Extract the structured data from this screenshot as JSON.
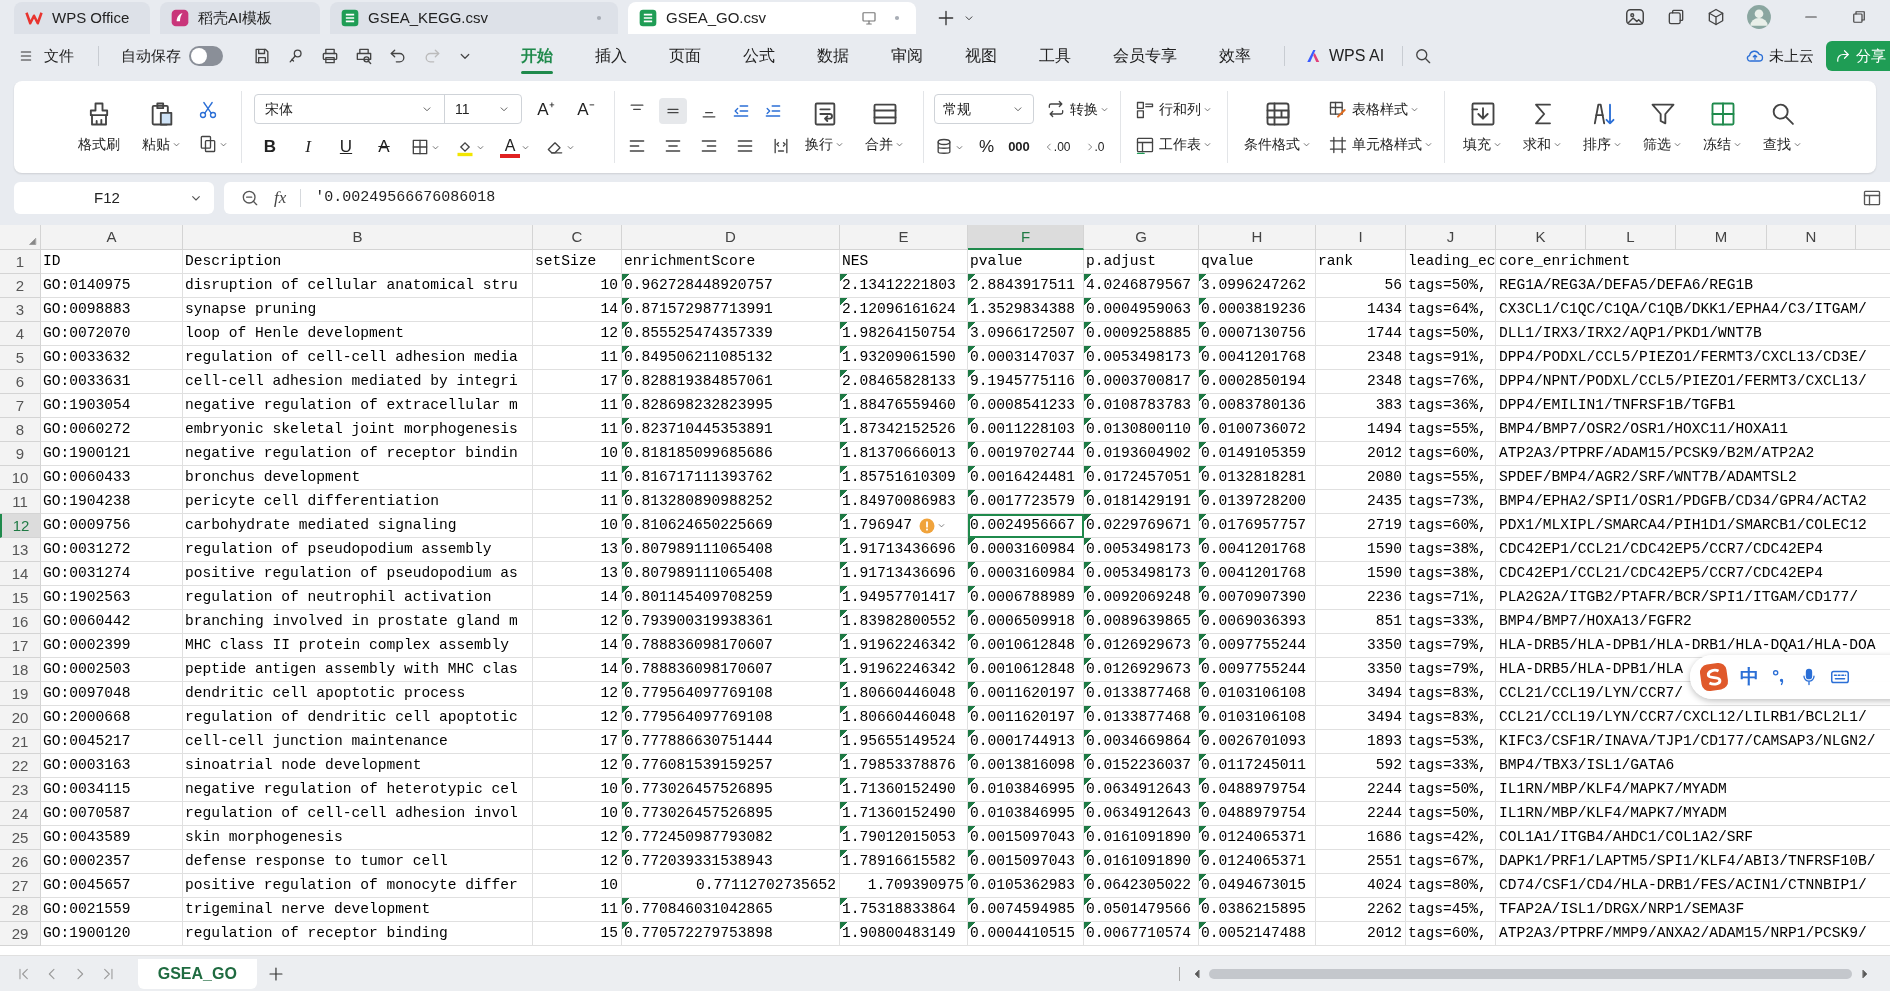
{
  "tabs": [
    {
      "label": "WPS Office",
      "kind": "app",
      "selected": false
    },
    {
      "label": "稻壳AI模板",
      "kind": "template",
      "selected": false
    },
    {
      "label": "GSEA_KEGG.csv",
      "kind": "sheet",
      "selected": false
    },
    {
      "label": "GSEA_GO.csv",
      "kind": "sheet",
      "selected": true
    }
  ],
  "quick_access": {
    "file_menu": "文件",
    "autosave_label": "自动保存",
    "autosave_on": false
  },
  "menu_tabs": [
    {
      "label": "开始",
      "selected": true
    },
    {
      "label": "插入",
      "selected": false
    },
    {
      "label": "页面",
      "selected": false
    },
    {
      "label": "公式",
      "selected": false
    },
    {
      "label": "数据",
      "selected": false
    },
    {
      "label": "审阅",
      "selected": false
    },
    {
      "label": "视图",
      "selected": false
    },
    {
      "label": "工具",
      "selected": false
    },
    {
      "label": "会员专享",
      "selected": false
    },
    {
      "label": "效率",
      "selected": false
    }
  ],
  "ai_button": "WPS AI",
  "cloud_status": "未上云",
  "share_button": "分享",
  "ribbon": {
    "format_painter": "格式刷",
    "paste": "粘贴",
    "font_name": "宋体",
    "font_size": "11",
    "grow_font": "A⁺",
    "shrink_font": "A⁻",
    "bold": "B",
    "italic": "I",
    "underline": "U",
    "strikethrough": "A",
    "font_color": "A",
    "align_middle_on": true,
    "wrap_text": "换行",
    "merge": "合并",
    "number_format": "常规",
    "convert": "转换",
    "percent": "%",
    "thousands": "000",
    "decimal_increase": ".00",
    "decimal_decrease": ".0",
    "rows_columns": "行和列",
    "worksheet": "工作表",
    "conditional_format": "条件格式",
    "table_style": "表格样式",
    "cell_style": "单元格样式",
    "fill": "填充",
    "sum": "求和",
    "sort": "排序",
    "filter": "筛选",
    "freeze": "冻结",
    "find": "查找"
  },
  "formula_bar": {
    "name_box": "F12",
    "fx": "fx",
    "formula": "'0.00249566676086018"
  },
  "columns": [
    {
      "letter": "A",
      "selected": false
    },
    {
      "letter": "B",
      "selected": false
    },
    {
      "letter": "C",
      "selected": false
    },
    {
      "letter": "D",
      "selected": false
    },
    {
      "letter": "E",
      "selected": false
    },
    {
      "letter": "F",
      "selected": true
    },
    {
      "letter": "G",
      "selected": false
    },
    {
      "letter": "H",
      "selected": false
    },
    {
      "letter": "I",
      "selected": false
    },
    {
      "letter": "J",
      "selected": false
    },
    {
      "letter": "K",
      "selected": false
    },
    {
      "letter": "L",
      "selected": false
    },
    {
      "letter": "M",
      "selected": false
    },
    {
      "letter": "N",
      "selected": false
    }
  ],
  "rows": [
    {
      "number": "1",
      "selected": false,
      "warning": false,
      "cells": [
        {
          "text": "ID",
          "kind": "text"
        },
        {
          "text": "Description",
          "kind": "text"
        },
        {
          "text": "setSize",
          "kind": "text"
        },
        {
          "text": "enrichmentScore",
          "kind": "text"
        },
        {
          "text": "NES",
          "kind": "text"
        },
        {
          "text": "pvalue",
          "kind": "text"
        },
        {
          "text": "p.adjust",
          "kind": "text"
        },
        {
          "text": "qvalue",
          "kind": "text"
        },
        {
          "text": "rank",
          "kind": "text"
        },
        {
          "text": "leading_ec",
          "kind": "text"
        },
        {
          "text": "core_enrichment",
          "kind": "text"
        }
      ]
    },
    {
      "number": "2",
      "selected": false,
      "warning": false,
      "cells": [
        {
          "text": "GO:0140975",
          "kind": "text"
        },
        {
          "text": "disruption of cellular anatomical stru",
          "kind": "text"
        },
        {
          "text": "10",
          "kind": "number"
        },
        {
          "text": "0.962728448920757",
          "kind": "numeric_text"
        },
        {
          "text": "2.13412221803",
          "kind": "numeric_text"
        },
        {
          "text": "2.8843917511",
          "kind": "numeric_text"
        },
        {
          "text": "4.0246879567",
          "kind": "numeric_text"
        },
        {
          "text": "3.0996247262",
          "kind": "numeric_text"
        },
        {
          "text": "56",
          "kind": "number"
        },
        {
          "text": "tags=50%,",
          "kind": "text"
        },
        {
          "text": "REG1A/REG3A/DEFA5/DEFA6/REG1B",
          "kind": "text"
        }
      ]
    },
    {
      "number": "3",
      "selected": false,
      "warning": false,
      "cells": [
        {
          "text": "GO:0098883",
          "kind": "text"
        },
        {
          "text": "synapse pruning",
          "kind": "text"
        },
        {
          "text": "14",
          "kind": "number"
        },
        {
          "text": "0.871572987713991",
          "kind": "numeric_text"
        },
        {
          "text": "2.12096161624",
          "kind": "numeric_text"
        },
        {
          "text": "1.3529834388",
          "kind": "numeric_text"
        },
        {
          "text": "0.0004959063",
          "kind": "numeric_text"
        },
        {
          "text": "0.0003819236",
          "kind": "numeric_text"
        },
        {
          "text": "1434",
          "kind": "number"
        },
        {
          "text": "tags=64%,",
          "kind": "text"
        },
        {
          "text": "CX3CL1/C1QC/C1QA/C1QB/DKK1/EPHA4/C3/ITGAM/",
          "kind": "text"
        }
      ]
    },
    {
      "number": "4",
      "selected": false,
      "warning": false,
      "cells": [
        {
          "text": "GO:0072070",
          "kind": "text"
        },
        {
          "text": "loop of Henle development",
          "kind": "text"
        },
        {
          "text": "12",
          "kind": "number"
        },
        {
          "text": "0.855525474357339",
          "kind": "numeric_text"
        },
        {
          "text": "1.98264150754",
          "kind": "numeric_text"
        },
        {
          "text": "3.0966172507",
          "kind": "numeric_text"
        },
        {
          "text": "0.0009258885",
          "kind": "numeric_text"
        },
        {
          "text": "0.0007130756",
          "kind": "numeric_text"
        },
        {
          "text": "1744",
          "kind": "number"
        },
        {
          "text": "tags=50%,",
          "kind": "text"
        },
        {
          "text": "DLL1/IRX3/IRX2/AQP1/PKD1/WNT7B",
          "kind": "text"
        }
      ]
    },
    {
      "number": "5",
      "selected": false,
      "warning": false,
      "cells": [
        {
          "text": "GO:0033632",
          "kind": "text"
        },
        {
          "text": "regulation of cell-cell adhesion media",
          "kind": "text"
        },
        {
          "text": "11",
          "kind": "number"
        },
        {
          "text": "0.849506211085132",
          "kind": "numeric_text"
        },
        {
          "text": "1.93209061590",
          "kind": "numeric_text"
        },
        {
          "text": "0.0003147037",
          "kind": "numeric_text"
        },
        {
          "text": "0.0053498173",
          "kind": "numeric_text"
        },
        {
          "text": "0.0041201768",
          "kind": "numeric_text"
        },
        {
          "text": "2348",
          "kind": "number"
        },
        {
          "text": "tags=91%,",
          "kind": "text"
        },
        {
          "text": "DPP4/PODXL/CCL5/PIEZO1/FERMT3/CXCL13/CD3E/",
          "kind": "text"
        }
      ]
    },
    {
      "number": "6",
      "selected": false,
      "warning": false,
      "cells": [
        {
          "text": "GO:0033631",
          "kind": "text"
        },
        {
          "text": "cell-cell adhesion mediated by integri",
          "kind": "text"
        },
        {
          "text": "17",
          "kind": "number"
        },
        {
          "text": "0.828819384857061",
          "kind": "numeric_text"
        },
        {
          "text": "2.08465828133",
          "kind": "numeric_text"
        },
        {
          "text": "9.1945775116",
          "kind": "numeric_text"
        },
        {
          "text": "0.0003700817",
          "kind": "numeric_text"
        },
        {
          "text": "0.0002850194",
          "kind": "numeric_text"
        },
        {
          "text": "2348",
          "kind": "number"
        },
        {
          "text": "tags=76%,",
          "kind": "text"
        },
        {
          "text": "DPP4/NPNT/PODXL/CCL5/PIEZO1/FERMT3/CXCL13/",
          "kind": "text"
        }
      ]
    },
    {
      "number": "7",
      "selected": false,
      "warning": false,
      "cells": [
        {
          "text": "GO:1903054",
          "kind": "text"
        },
        {
          "text": "negative regulation of extracellular m",
          "kind": "text"
        },
        {
          "text": "11",
          "kind": "number"
        },
        {
          "text": "0.828698232823995",
          "kind": "numeric_text"
        },
        {
          "text": "1.88476559460",
          "kind": "numeric_text"
        },
        {
          "text": "0.0008541233",
          "kind": "numeric_text"
        },
        {
          "text": "0.0108783783",
          "kind": "numeric_text"
        },
        {
          "text": "0.0083780136",
          "kind": "numeric_text"
        },
        {
          "text": "383",
          "kind": "number"
        },
        {
          "text": "tags=36%,",
          "kind": "text"
        },
        {
          "text": "DPP4/EMILIN1/TNFRSF1B/TGFB1",
          "kind": "text"
        }
      ]
    },
    {
      "number": "8",
      "selected": false,
      "warning": false,
      "cells": [
        {
          "text": "GO:0060272",
          "kind": "text"
        },
        {
          "text": "embryonic skeletal joint morphogenesis",
          "kind": "text"
        },
        {
          "text": "11",
          "kind": "number"
        },
        {
          "text": "0.823710445353891",
          "kind": "numeric_text"
        },
        {
          "text": "1.87342152526",
          "kind": "numeric_text"
        },
        {
          "text": "0.0011228103",
          "kind": "numeric_text"
        },
        {
          "text": "0.0130800110",
          "kind": "numeric_text"
        },
        {
          "text": "0.0100736072",
          "kind": "numeric_text"
        },
        {
          "text": "1494",
          "kind": "number"
        },
        {
          "text": "tags=55%,",
          "kind": "text"
        },
        {
          "text": "BMP4/BMP7/OSR2/OSR1/HOXC11/HOXA11",
          "kind": "text"
        }
      ]
    },
    {
      "number": "9",
      "selected": false,
      "warning": false,
      "cells": [
        {
          "text": "GO:1900121",
          "kind": "text"
        },
        {
          "text": "negative regulation of receptor bindin",
          "kind": "text"
        },
        {
          "text": "10",
          "kind": "number"
        },
        {
          "text": "0.818185099685686",
          "kind": "numeric_text"
        },
        {
          "text": "1.81370666013",
          "kind": "numeric_text"
        },
        {
          "text": "0.0019702744",
          "kind": "numeric_text"
        },
        {
          "text": "0.0193604902",
          "kind": "numeric_text"
        },
        {
          "text": "0.0149105359",
          "kind": "numeric_text"
        },
        {
          "text": "2012",
          "kind": "number"
        },
        {
          "text": "tags=60%,",
          "kind": "text"
        },
        {
          "text": "ATP2A3/PTPRF/ADAM15/PCSK9/B2M/ATP2A2",
          "kind": "text"
        }
      ]
    },
    {
      "number": "10",
      "selected": false,
      "warning": false,
      "cells": [
        {
          "text": "GO:0060433",
          "kind": "text"
        },
        {
          "text": "bronchus development",
          "kind": "text"
        },
        {
          "text": "11",
          "kind": "number"
        },
        {
          "text": "0.816717111393762",
          "kind": "numeric_text"
        },
        {
          "text": "1.85751610309",
          "kind": "numeric_text"
        },
        {
          "text": "0.0016424481",
          "kind": "numeric_text"
        },
        {
          "text": "0.0172457051",
          "kind": "numeric_text"
        },
        {
          "text": "0.0132818281",
          "kind": "numeric_text"
        },
        {
          "text": "2080",
          "kind": "number"
        },
        {
          "text": "tags=55%,",
          "kind": "text"
        },
        {
          "text": "SPDEF/BMP4/AGR2/SRF/WNT7B/ADAMTSL2",
          "kind": "text"
        }
      ]
    },
    {
      "number": "11",
      "selected": false,
      "warning": false,
      "cells": [
        {
          "text": "GO:1904238",
          "kind": "text"
        },
        {
          "text": "pericyte cell differentiation",
          "kind": "text"
        },
        {
          "text": "11",
          "kind": "number"
        },
        {
          "text": "0.813280890988252",
          "kind": "numeric_text"
        },
        {
          "text": "1.84970086983",
          "kind": "numeric_text"
        },
        {
          "text": "0.0017723579",
          "kind": "numeric_text"
        },
        {
          "text": "0.0181429191",
          "kind": "numeric_text"
        },
        {
          "text": "0.0139728200",
          "kind": "numeric_text"
        },
        {
          "text": "2435",
          "kind": "number"
        },
        {
          "text": "tags=73%,",
          "kind": "text"
        },
        {
          "text": "BMP4/EPHA2/SPI1/OSR1/PDGFB/CD34/GPR4/ACTA2",
          "kind": "text"
        }
      ]
    },
    {
      "number": "12",
      "selected": true,
      "warning": true,
      "cells": [
        {
          "text": "GO:0009756",
          "kind": "text"
        },
        {
          "text": "carbohydrate mediated signaling",
          "kind": "text"
        },
        {
          "text": "10",
          "kind": "number"
        },
        {
          "text": "0.810624650225669",
          "kind": "numeric_text"
        },
        {
          "text": "1.796947",
          "kind": "numeric_text"
        },
        {
          "text": "0.0024956667",
          "kind": "numeric_text"
        },
        {
          "text": "0.0229769671",
          "kind": "numeric_text"
        },
        {
          "text": "0.0176957757",
          "kind": "numeric_text"
        },
        {
          "text": "2719",
          "kind": "number"
        },
        {
          "text": "tags=60%,",
          "kind": "text"
        },
        {
          "text": "PDX1/MLXIPL/SMARCA4/PIH1D1/SMARCB1/COLEC12",
          "kind": "text"
        }
      ]
    },
    {
      "number": "13",
      "selected": false,
      "warning": false,
      "cells": [
        {
          "text": "GO:0031272",
          "kind": "text"
        },
        {
          "text": "regulation of pseudopodium assembly",
          "kind": "text"
        },
        {
          "text": "13",
          "kind": "number"
        },
        {
          "text": "0.807989111065408",
          "kind": "numeric_text"
        },
        {
          "text": "1.91713436696",
          "kind": "numeric_text"
        },
        {
          "text": "0.0003160984",
          "kind": "numeric_text"
        },
        {
          "text": "0.0053498173",
          "kind": "numeric_text"
        },
        {
          "text": "0.0041201768",
          "kind": "numeric_text"
        },
        {
          "text": "1590",
          "kind": "number"
        },
        {
          "text": "tags=38%,",
          "kind": "text"
        },
        {
          "text": "CDC42EP1/CCL21/CDC42EP5/CCR7/CDC42EP4",
          "kind": "text"
        }
      ]
    },
    {
      "number": "14",
      "selected": false,
      "warning": false,
      "cells": [
        {
          "text": "GO:0031274",
          "kind": "text"
        },
        {
          "text": "positive regulation of pseudopodium as",
          "kind": "text"
        },
        {
          "text": "13",
          "kind": "number"
        },
        {
          "text": "0.807989111065408",
          "kind": "numeric_text"
        },
        {
          "text": "1.91713436696",
          "kind": "numeric_text"
        },
        {
          "text": "0.0003160984",
          "kind": "numeric_text"
        },
        {
          "text": "0.0053498173",
          "kind": "numeric_text"
        },
        {
          "text": "0.0041201768",
          "kind": "numeric_text"
        },
        {
          "text": "1590",
          "kind": "number"
        },
        {
          "text": "tags=38%,",
          "kind": "text"
        },
        {
          "text": "CDC42EP1/CCL21/CDC42EP5/CCR7/CDC42EP4",
          "kind": "text"
        }
      ]
    },
    {
      "number": "15",
      "selected": false,
      "warning": false,
      "cells": [
        {
          "text": "GO:1902563",
          "kind": "text"
        },
        {
          "text": "regulation of neutrophil activation",
          "kind": "text"
        },
        {
          "text": "14",
          "kind": "number"
        },
        {
          "text": "0.801145409708259",
          "kind": "numeric_text"
        },
        {
          "text": "1.94957701417",
          "kind": "numeric_text"
        },
        {
          "text": "0.0006788989",
          "kind": "numeric_text"
        },
        {
          "text": "0.0092069248",
          "kind": "numeric_text"
        },
        {
          "text": "0.0070907390",
          "kind": "numeric_text"
        },
        {
          "text": "2236",
          "kind": "number"
        },
        {
          "text": "tags=71%,",
          "kind": "text"
        },
        {
          "text": "PLA2G2A/ITGB2/PTAFR/BCR/SPI1/ITGAM/CD177/",
          "kind": "text"
        }
      ]
    },
    {
      "number": "16",
      "selected": false,
      "warning": false,
      "cells": [
        {
          "text": "GO:0060442",
          "kind": "text"
        },
        {
          "text": "branching involved in prostate gland m",
          "kind": "text"
        },
        {
          "text": "12",
          "kind": "number"
        },
        {
          "text": "0.793900319938361",
          "kind": "numeric_text"
        },
        {
          "text": "1.83982800552",
          "kind": "numeric_text"
        },
        {
          "text": "0.0006509918",
          "kind": "numeric_text"
        },
        {
          "text": "0.0089639865",
          "kind": "numeric_text"
        },
        {
          "text": "0.0069036393",
          "kind": "numeric_text"
        },
        {
          "text": "851",
          "kind": "number"
        },
        {
          "text": "tags=33%,",
          "kind": "text"
        },
        {
          "text": "BMP4/BMP7/HOXA13/FGFR2",
          "kind": "text"
        }
      ]
    },
    {
      "number": "17",
      "selected": false,
      "warning": false,
      "cells": [
        {
          "text": "GO:0002399",
          "kind": "text"
        },
        {
          "text": "MHC class II protein complex assembly",
          "kind": "text"
        },
        {
          "text": "14",
          "kind": "number"
        },
        {
          "text": "0.788836098170607",
          "kind": "numeric_text"
        },
        {
          "text": "1.91962246342",
          "kind": "numeric_text"
        },
        {
          "text": "0.0010612848",
          "kind": "numeric_text"
        },
        {
          "text": "0.0126929673",
          "kind": "numeric_text"
        },
        {
          "text": "0.0097755244",
          "kind": "numeric_text"
        },
        {
          "text": "3350",
          "kind": "number"
        },
        {
          "text": "tags=79%,",
          "kind": "text"
        },
        {
          "text": "HLA-DRB5/HLA-DPB1/HLA-DRB1/HLA-DQA1/HLA-DOA",
          "kind": "text"
        }
      ]
    },
    {
      "number": "18",
      "selected": false,
      "warning": false,
      "cells": [
        {
          "text": "GO:0002503",
          "kind": "text"
        },
        {
          "text": "peptide antigen assembly with MHC clas",
          "kind": "text"
        },
        {
          "text": "14",
          "kind": "number"
        },
        {
          "text": "0.788836098170607",
          "kind": "numeric_text"
        },
        {
          "text": "1.91962246342",
          "kind": "numeric_text"
        },
        {
          "text": "0.0010612848",
          "kind": "numeric_text"
        },
        {
          "text": "0.0126929673",
          "kind": "numeric_text"
        },
        {
          "text": "0.0097755244",
          "kind": "numeric_text"
        },
        {
          "text": "3350",
          "kind": "number"
        },
        {
          "text": "tags=79%,",
          "kind": "text"
        },
        {
          "text": "HLA-DRB5/HLA-DPB1/HLA",
          "kind": "text"
        }
      ]
    },
    {
      "number": "19",
      "selected": false,
      "warning": false,
      "cells": [
        {
          "text": "GO:0097048",
          "kind": "text"
        },
        {
          "text": "dendritic cell apoptotic process",
          "kind": "text"
        },
        {
          "text": "12",
          "kind": "number"
        },
        {
          "text": "0.779564097769108",
          "kind": "numeric_text"
        },
        {
          "text": "1.80660446048",
          "kind": "numeric_text"
        },
        {
          "text": "0.0011620197",
          "kind": "numeric_text"
        },
        {
          "text": "0.0133877468",
          "kind": "numeric_text"
        },
        {
          "text": "0.0103106108",
          "kind": "numeric_text"
        },
        {
          "text": "3494",
          "kind": "number"
        },
        {
          "text": "tags=83%,",
          "kind": "text"
        },
        {
          "text": "CCL21/CCL19/LYN/CCR7/",
          "kind": "text"
        }
      ]
    },
    {
      "number": "20",
      "selected": false,
      "warning": false,
      "cells": [
        {
          "text": "GO:2000668",
          "kind": "text"
        },
        {
          "text": "regulation of dendritic cell apoptotic",
          "kind": "text"
        },
        {
          "text": "12",
          "kind": "number"
        },
        {
          "text": "0.779564097769108",
          "kind": "numeric_text"
        },
        {
          "text": "1.80660446048",
          "kind": "numeric_text"
        },
        {
          "text": "0.0011620197",
          "kind": "numeric_text"
        },
        {
          "text": "0.0133877468",
          "kind": "numeric_text"
        },
        {
          "text": "0.0103106108",
          "kind": "numeric_text"
        },
        {
          "text": "3494",
          "kind": "number"
        },
        {
          "text": "tags=83%,",
          "kind": "text"
        },
        {
          "text": "CCL21/CCL19/LYN/CCR7/CXCL12/LILRB1/BCL2L1/",
          "kind": "text"
        }
      ]
    },
    {
      "number": "21",
      "selected": false,
      "warning": false,
      "cells": [
        {
          "text": "GO:0045217",
          "kind": "text"
        },
        {
          "text": "cell-cell junction maintenance",
          "kind": "text"
        },
        {
          "text": "17",
          "kind": "number"
        },
        {
          "text": "0.777886630751444",
          "kind": "numeric_text"
        },
        {
          "text": "1.95655149524",
          "kind": "numeric_text"
        },
        {
          "text": "0.0001744913",
          "kind": "numeric_text"
        },
        {
          "text": "0.0034669864",
          "kind": "numeric_text"
        },
        {
          "text": "0.0026701093",
          "kind": "numeric_text"
        },
        {
          "text": "1893",
          "kind": "number"
        },
        {
          "text": "tags=53%,",
          "kind": "text"
        },
        {
          "text": "KIFC3/CSF1R/INAVA/TJP1/CD177/CAMSAP3/NLGN2/",
          "kind": "text"
        }
      ]
    },
    {
      "number": "22",
      "selected": false,
      "warning": false,
      "cells": [
        {
          "text": "GO:0003163",
          "kind": "text"
        },
        {
          "text": "sinoatrial node development",
          "kind": "text"
        },
        {
          "text": "12",
          "kind": "number"
        },
        {
          "text": "0.776081539159257",
          "kind": "numeric_text"
        },
        {
          "text": "1.79853378876",
          "kind": "numeric_text"
        },
        {
          "text": "0.0013816098",
          "kind": "numeric_text"
        },
        {
          "text": "0.0152236037",
          "kind": "numeric_text"
        },
        {
          "text": "0.0117245011",
          "kind": "numeric_text"
        },
        {
          "text": "592",
          "kind": "number"
        },
        {
          "text": "tags=33%,",
          "kind": "text"
        },
        {
          "text": "BMP4/TBX3/ISL1/GATA6",
          "kind": "text"
        }
      ]
    },
    {
      "number": "23",
      "selected": false,
      "warning": false,
      "cells": [
        {
          "text": "GO:0034115",
          "kind": "text"
        },
        {
          "text": "negative regulation of heterotypic cel",
          "kind": "text"
        },
        {
          "text": "10",
          "kind": "number"
        },
        {
          "text": "0.773026457526895",
          "kind": "numeric_text"
        },
        {
          "text": "1.71360152490",
          "kind": "numeric_text"
        },
        {
          "text": "0.0103846995",
          "kind": "numeric_text"
        },
        {
          "text": "0.0634912643",
          "kind": "numeric_text"
        },
        {
          "text": "0.0488979754",
          "kind": "numeric_text"
        },
        {
          "text": "2244",
          "kind": "number"
        },
        {
          "text": "tags=50%,",
          "kind": "text"
        },
        {
          "text": "IL1RN/MBP/KLF4/MAPK7/MYADM",
          "kind": "text"
        }
      ]
    },
    {
      "number": "24",
      "selected": false,
      "warning": false,
      "cells": [
        {
          "text": "GO:0070587",
          "kind": "text"
        },
        {
          "text": "regulation of cell-cell adhesion invol",
          "kind": "text"
        },
        {
          "text": "10",
          "kind": "number"
        },
        {
          "text": "0.773026457526895",
          "kind": "numeric_text"
        },
        {
          "text": "1.71360152490",
          "kind": "numeric_text"
        },
        {
          "text": "0.0103846995",
          "kind": "numeric_text"
        },
        {
          "text": "0.0634912643",
          "kind": "numeric_text"
        },
        {
          "text": "0.0488979754",
          "kind": "numeric_text"
        },
        {
          "text": "2244",
          "kind": "number"
        },
        {
          "text": "tags=50%,",
          "kind": "text"
        },
        {
          "text": "IL1RN/MBP/KLF4/MAPK7/MYADM",
          "kind": "text"
        }
      ]
    },
    {
      "number": "25",
      "selected": false,
      "warning": false,
      "cells": [
        {
          "text": "GO:0043589",
          "kind": "text"
        },
        {
          "text": "skin morphogenesis",
          "kind": "text"
        },
        {
          "text": "12",
          "kind": "number"
        },
        {
          "text": "0.772450987793082",
          "kind": "numeric_text"
        },
        {
          "text": "1.79012015053",
          "kind": "numeric_text"
        },
        {
          "text": "0.0015097043",
          "kind": "numeric_text"
        },
        {
          "text": "0.0161091890",
          "kind": "numeric_text"
        },
        {
          "text": "0.0124065371",
          "kind": "numeric_text"
        },
        {
          "text": "1686",
          "kind": "number"
        },
        {
          "text": "tags=42%,",
          "kind": "text"
        },
        {
          "text": "COL1A1/ITGB4/AHDC1/COL1A2/SRF",
          "kind": "text"
        }
      ]
    },
    {
      "number": "26",
      "selected": false,
      "warning": false,
      "cells": [
        {
          "text": "GO:0002357",
          "kind": "text"
        },
        {
          "text": "defense response to tumor cell",
          "kind": "text"
        },
        {
          "text": "12",
          "kind": "number"
        },
        {
          "text": "0.772039331538943",
          "kind": "numeric_text"
        },
        {
          "text": "1.78916615582",
          "kind": "numeric_text"
        },
        {
          "text": "0.0015097043",
          "kind": "numeric_text"
        },
        {
          "text": "0.0161091890",
          "kind": "numeric_text"
        },
        {
          "text": "0.0124065371",
          "kind": "numeric_text"
        },
        {
          "text": "2551",
          "kind": "number"
        },
        {
          "text": "tags=67%,",
          "kind": "text"
        },
        {
          "text": "DAPK1/PRF1/LAPTM5/SPI1/KLF4/ABI3/TNFRSF10B/",
          "kind": "text"
        }
      ]
    },
    {
      "number": "27",
      "selected": false,
      "warning": false,
      "cells": [
        {
          "text": "GO:0045657",
          "kind": "text"
        },
        {
          "text": "positive regulation of monocyte differ",
          "kind": "text"
        },
        {
          "text": "10",
          "kind": "number"
        },
        {
          "text": "0.77112702735652",
          "kind": "number"
        },
        {
          "text": "1.709390975",
          "kind": "number"
        },
        {
          "text": "0.0105362983",
          "kind": "numeric_text"
        },
        {
          "text": "0.0642305022",
          "kind": "numeric_text"
        },
        {
          "text": "0.0494673015",
          "kind": "numeric_text"
        },
        {
          "text": "4024",
          "kind": "number"
        },
        {
          "text": "tags=80%,",
          "kind": "text"
        },
        {
          "text": "CD74/CSF1/CD4/HLA-DRB1/FES/ACIN1/CTNNBIP1/",
          "kind": "text"
        }
      ]
    },
    {
      "number": "28",
      "selected": false,
      "warning": false,
      "cells": [
        {
          "text": "GO:0021559",
          "kind": "text"
        },
        {
          "text": "trigeminal nerve development",
          "kind": "text"
        },
        {
          "text": "11",
          "kind": "number"
        },
        {
          "text": "0.770846031042865",
          "kind": "numeric_text"
        },
        {
          "text": "1.75318833864",
          "kind": "numeric_text"
        },
        {
          "text": "0.0074594985",
          "kind": "numeric_text"
        },
        {
          "text": "0.0501479566",
          "kind": "numeric_text"
        },
        {
          "text": "0.0386215895",
          "kind": "numeric_text"
        },
        {
          "text": "2262",
          "kind": "number"
        },
        {
          "text": "tags=45%,",
          "kind": "text"
        },
        {
          "text": "TFAP2A/ISL1/DRGX/NRP1/SEMA3F",
          "kind": "text"
        }
      ]
    },
    {
      "number": "29",
      "selected": false,
      "warning": false,
      "cells": [
        {
          "text": "GO:1900120",
          "kind": "text"
        },
        {
          "text": "regulation of receptor binding",
          "kind": "text"
        },
        {
          "text": "15",
          "kind": "number"
        },
        {
          "text": "0.770572279753898",
          "kind": "numeric_text"
        },
        {
          "text": "1.90800483149",
          "kind": "numeric_text"
        },
        {
          "text": "0.0004410515",
          "kind": "numeric_text"
        },
        {
          "text": "0.0067710574",
          "kind": "numeric_text"
        },
        {
          "text": "0.0052147488",
          "kind": "numeric_text"
        },
        {
          "text": "2012",
          "kind": "number"
        },
        {
          "text": "tags=60%,",
          "kind": "text"
        },
        {
          "text": "ATP2A3/PTPRF/MMP9/ANXA2/ADAM15/NRP1/PCSK9/",
          "kind": "text"
        }
      ]
    }
  ],
  "sheet_tabs": [
    {
      "label": "GSEA_GO",
      "selected": true
    }
  ],
  "ime_bar": {
    "mode": "中"
  }
}
